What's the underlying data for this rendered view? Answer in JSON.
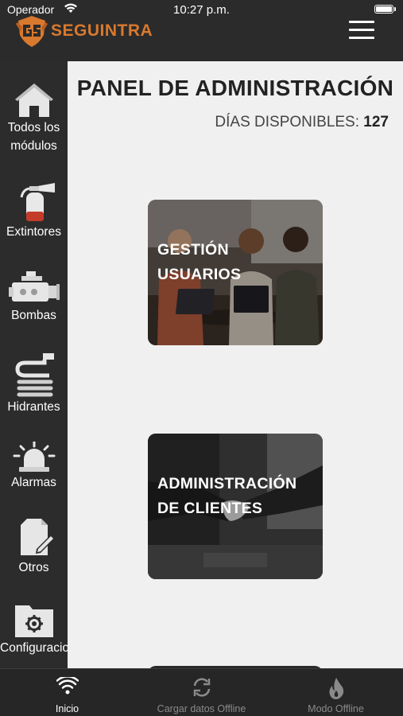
{
  "status_bar": {
    "carrier": "Operador",
    "time": "10:27 p.m."
  },
  "header": {
    "logo_text": "SEGUINTRA",
    "menu_icon": "hamburger-menu-icon"
  },
  "sidebar": {
    "items": [
      {
        "label_line1": "Todos los",
        "label_line2": "módulos",
        "icon": "home-icon"
      },
      {
        "label": "Extintores",
        "icon": "fire-extinguisher-icon"
      },
      {
        "label": "Bombas",
        "icon": "pump-icon"
      },
      {
        "label": "Hidrantes",
        "icon": "hydrant-hose-icon"
      },
      {
        "label": "Alarmas",
        "icon": "alarm-light-icon"
      },
      {
        "label": "Otros",
        "icon": "document-edit-icon"
      },
      {
        "label": "Configuracio",
        "icon": "settings-folder-icon"
      }
    ]
  },
  "main": {
    "title": "PANEL DE ADMINISTRACIÓN",
    "days_label": "DÍAS DISPONIBLES:",
    "days_value": "127",
    "cards": [
      {
        "line1": "GESTIÓN",
        "line2": "USUARIOS"
      },
      {
        "line1": "ADMINISTRACIÓN",
        "line2": "DE CLIENTES"
      }
    ]
  },
  "tabbar": {
    "tabs": [
      {
        "label": "Inicio",
        "icon": "wifi-icon",
        "active": true
      },
      {
        "label": "Cargar datos Offline",
        "icon": "sync-icon",
        "active": false
      },
      {
        "label": "Modo Offline",
        "icon": "flame-icon",
        "active": false
      }
    ]
  },
  "colors": {
    "brand": "#d9792e",
    "sidebar_bg": "#2c2c2c",
    "main_bg": "#f0f0f0",
    "tab_active": "#ffffff",
    "tab_inactive": "#8a8a8a"
  }
}
